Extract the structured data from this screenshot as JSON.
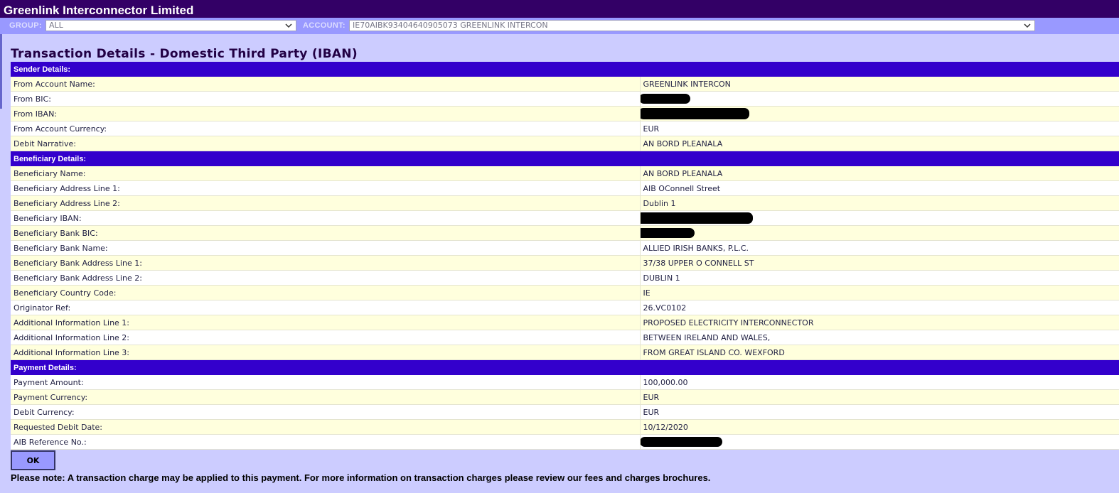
{
  "header": {
    "title": "Greenlink Interconnector Limited",
    "group_label": "GROUP:",
    "group_value": "ALL",
    "account_label": "ACCOUNT:",
    "account_value": "IE70AIBK93404640905073 GREENLINK INTERCON"
  },
  "page_title": "Transaction Details - Domestic Third Party (IBAN)",
  "sections": {
    "sender": {
      "heading": "Sender Details:",
      "rows": [
        {
          "label": "From Account Name:",
          "value": "GREENLINK INTERCON"
        },
        {
          "label": "From BIC:",
          "value": ""
        },
        {
          "label": "From IBAN:",
          "value": ""
        },
        {
          "label": "From Account Currency:",
          "value": "EUR"
        },
        {
          "label": "Debit Narrative:",
          "value": "AN BORD PLEANALA"
        }
      ]
    },
    "beneficiary": {
      "heading": "Beneficiary Details:",
      "rows": [
        {
          "label": "Beneficiary Name:",
          "value": "AN BORD PLEANALA"
        },
        {
          "label": "Beneficiary Address Line 1:",
          "value": "AIB OConnell Street"
        },
        {
          "label": "Beneficiary Address Line 2:",
          "value": "Dublin 1"
        },
        {
          "label": "Beneficiary IBAN:",
          "value": ""
        },
        {
          "label": "Beneficiary Bank BIC:",
          "value": ""
        },
        {
          "label": "Beneficiary Bank Name:",
          "value": "ALLIED IRISH BANKS, P.L.C."
        },
        {
          "label": "Beneficiary Bank Address Line 1:",
          "value": "37/38 UPPER O CONNELL ST"
        },
        {
          "label": "Beneficiary Bank Address Line 2:",
          "value": "DUBLIN 1"
        },
        {
          "label": "Beneficiary Country Code:",
          "value": "IE"
        },
        {
          "label": "Originator Ref:",
          "value": "26.VC0102"
        },
        {
          "label": "Additional Information Line 1:",
          "value": "PROPOSED ELECTRICITY INTERCONNECTOR"
        },
        {
          "label": "Additional Information Line 2:",
          "value": "BETWEEN IRELAND AND WALES,"
        },
        {
          "label": "Additional Information Line 3:",
          "value": "FROM GREAT ISLAND CO. WEXFORD"
        }
      ]
    },
    "payment": {
      "heading": "Payment Details:",
      "rows": [
        {
          "label": "Payment Amount:",
          "value": "100,000.00"
        },
        {
          "label": "Payment Currency:",
          "value": "EUR"
        },
        {
          "label": "Debit Currency:",
          "value": "EUR"
        },
        {
          "label": "Requested Debit Date:",
          "value": "10/12/2020"
        },
        {
          "label": "AIB Reference No.:",
          "value": ""
        }
      ]
    }
  },
  "ok_label": "OK",
  "note": "Please note: A transaction charge may be applied to this payment. For more information on transaction charges please review our fees and charges brochures.",
  "colors": {
    "title_bar": "#330066",
    "filter_bar": "#9999ff",
    "section_header": "#3300cc",
    "row_highlight": "#ffffdd",
    "page_background": "#ccccff"
  }
}
